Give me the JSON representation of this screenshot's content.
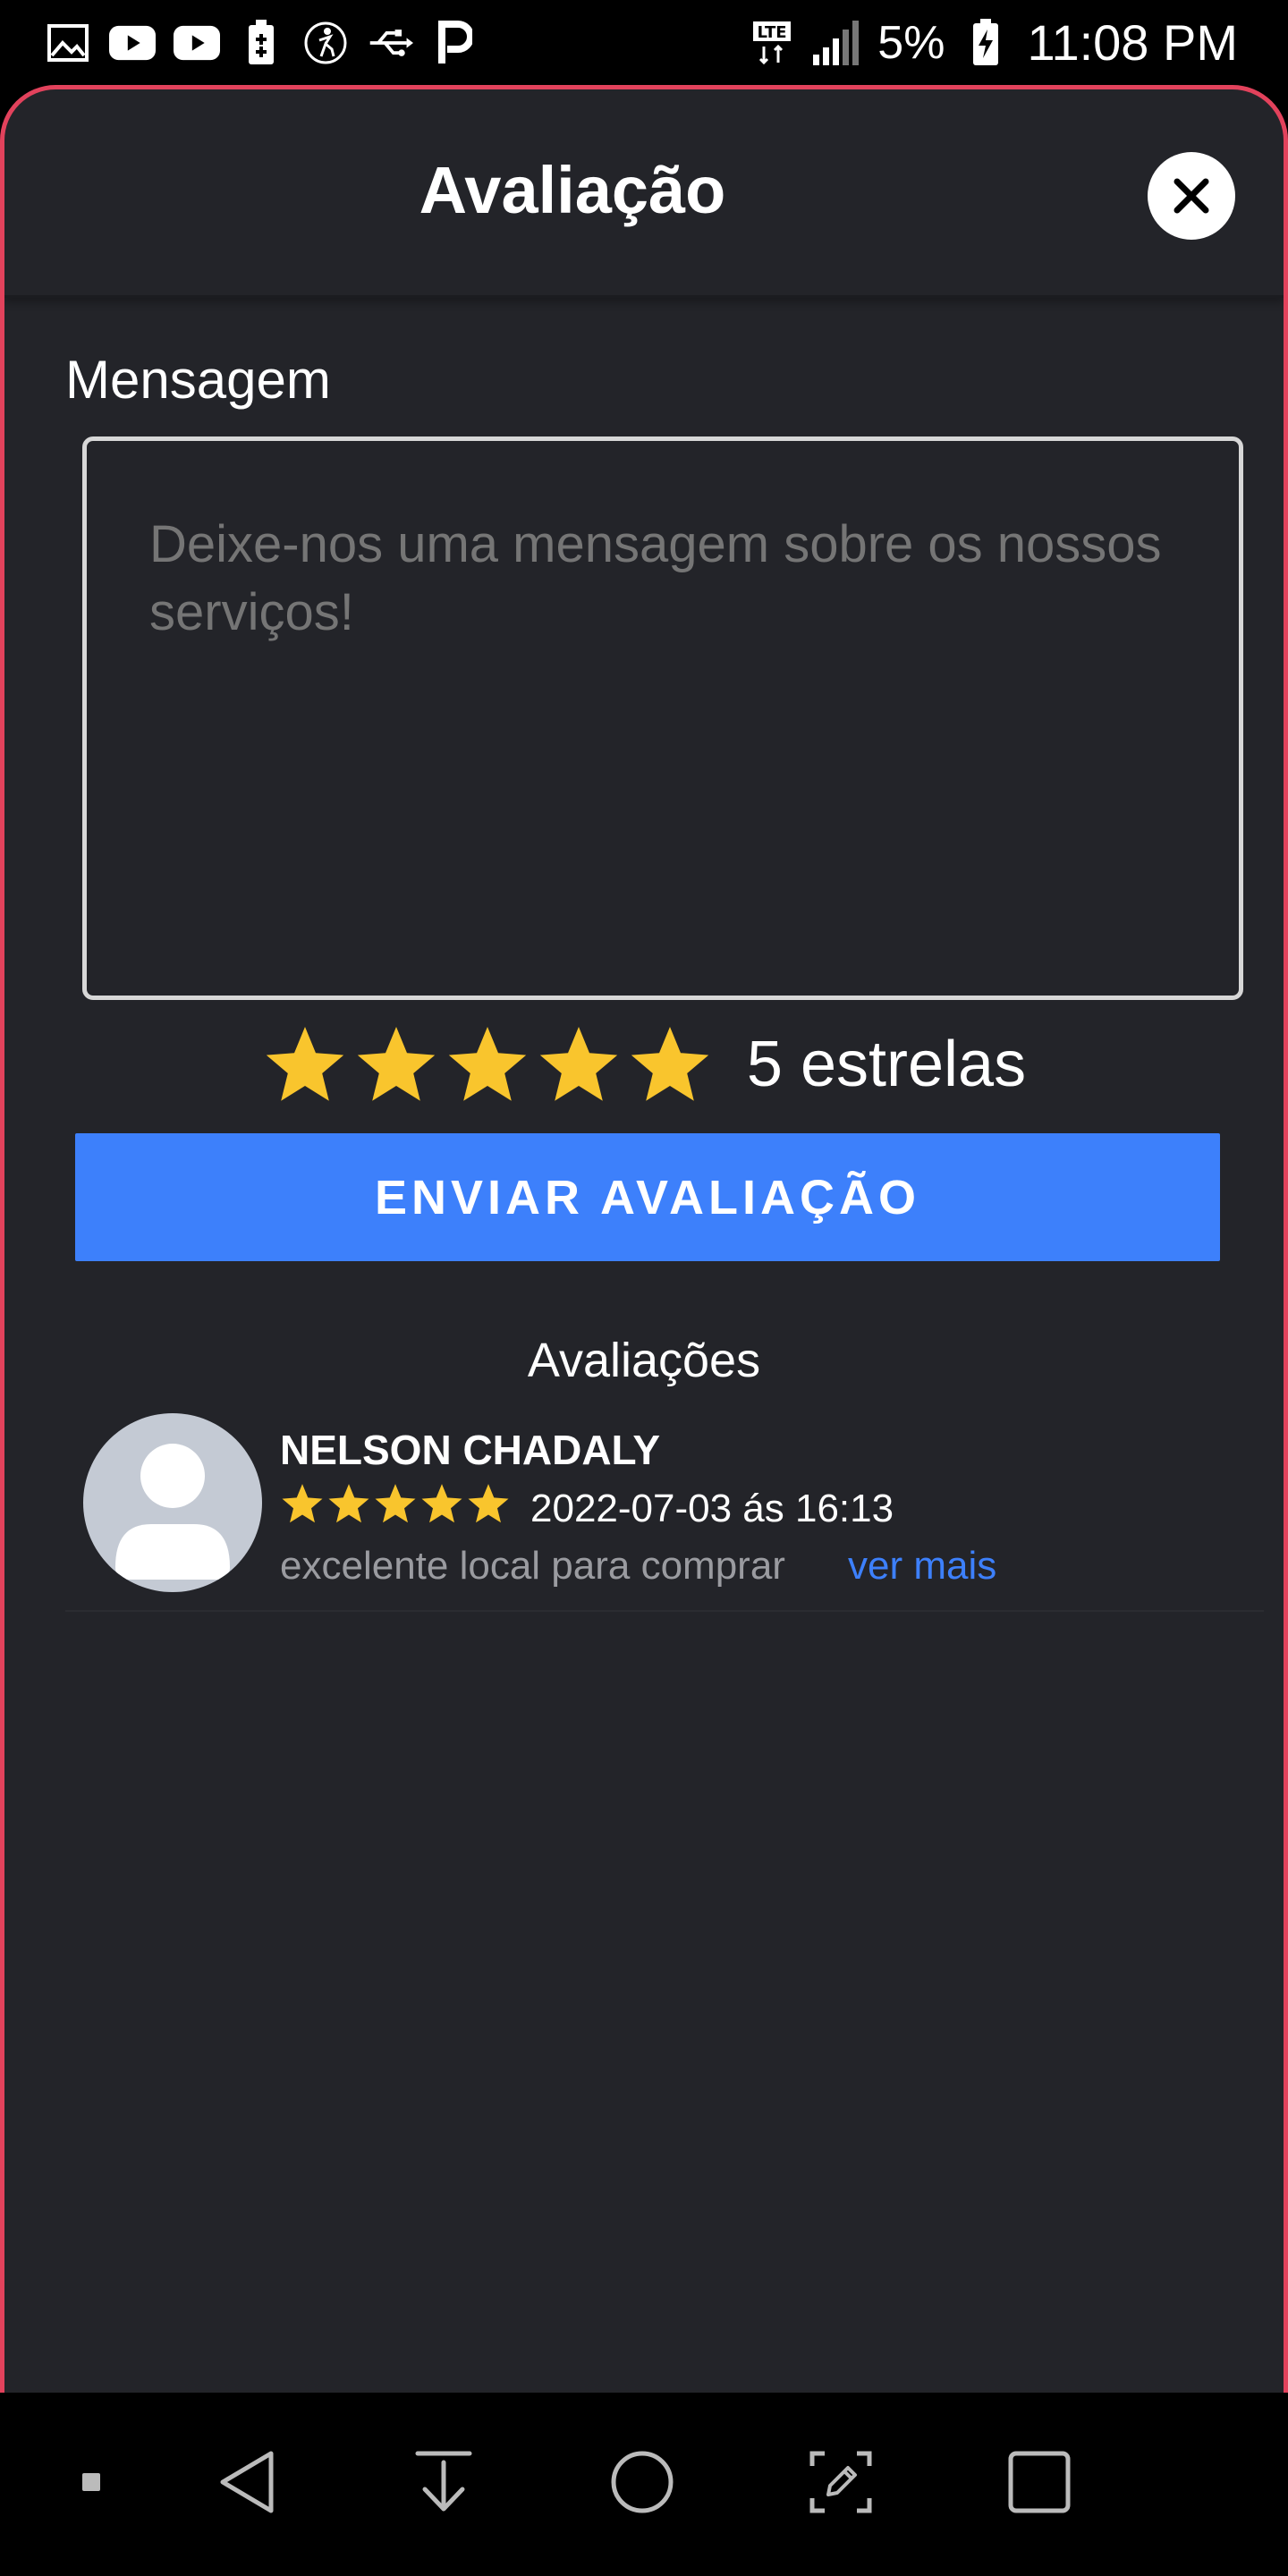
{
  "status_bar": {
    "icons_left": [
      "image-icon",
      "youtube-icon",
      "youtube-icon",
      "battery-saver-icon",
      "accessibility-icon",
      "usb-icon",
      "p-icon"
    ],
    "network": "LTE",
    "battery": "5%",
    "time": "11:08 PM"
  },
  "header": {
    "title": "Avaliação",
    "close_icon": "close-icon"
  },
  "form": {
    "message_label": "Mensagem",
    "message_placeholder": "Deixe-nos uma mensagem sobre os nossos serviços!",
    "message_value": "",
    "rating": 5,
    "rating_max": 5,
    "rating_text": "5 estrelas",
    "submit_label": "ENVIAR AVALIAÇÃO"
  },
  "reviews": {
    "title": "Avaliações",
    "items": [
      {
        "name": "NELSON CHADALY",
        "stars": 5,
        "date": "2022-07-03 ás 16:13",
        "comment": "excelente local para comprar",
        "see_more": "ver mais"
      }
    ]
  },
  "colors": {
    "accent": "#3d80fb",
    "star": "#f9c52d",
    "sheet_border": "#e2425c",
    "background": "#232429"
  },
  "nav_bar": {
    "icons": [
      "dot-icon",
      "back-icon",
      "download-icon",
      "home-icon",
      "edit-screen-icon",
      "recents-icon"
    ]
  }
}
